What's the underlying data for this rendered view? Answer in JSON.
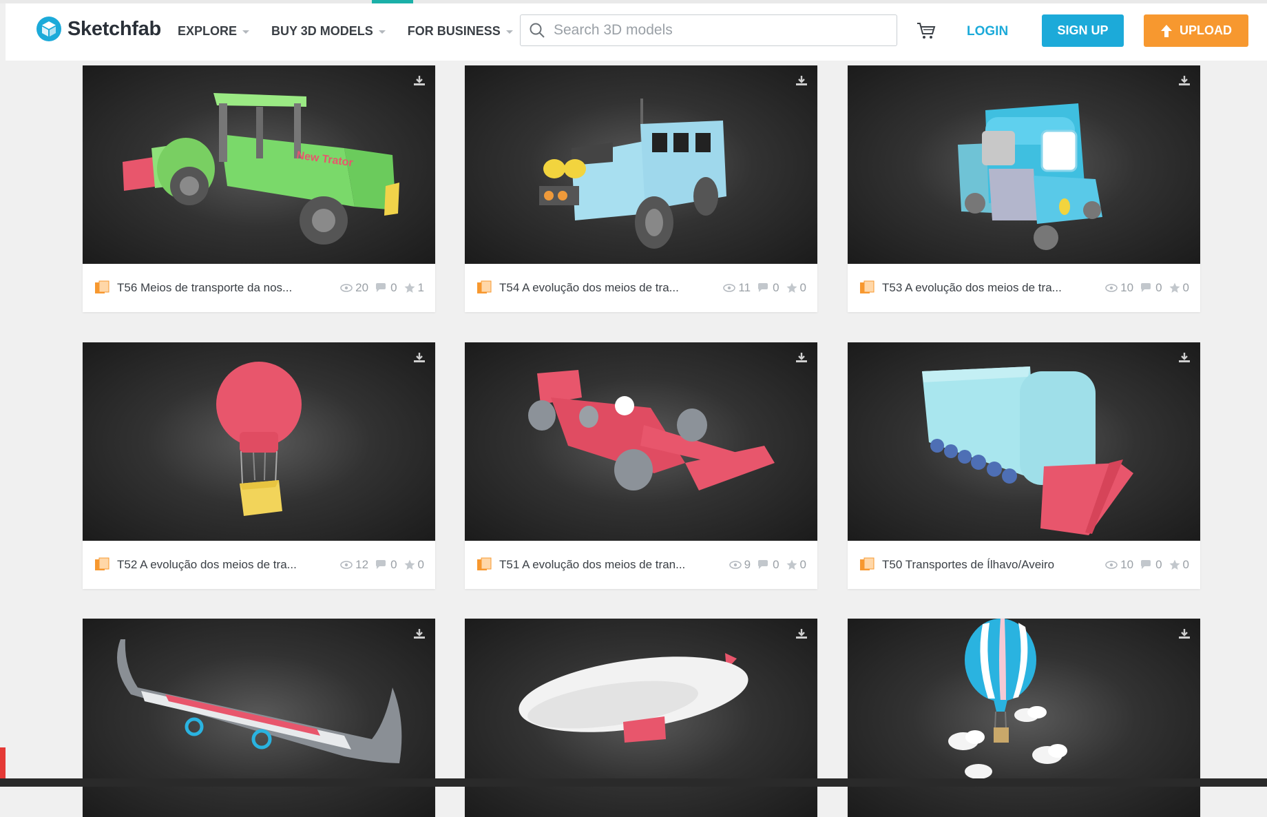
{
  "brand": {
    "name": "Sketchfab",
    "accent": "#1caad9"
  },
  "nav": [
    {
      "label": "EXPLORE"
    },
    {
      "label": "BUY 3D MODELS"
    },
    {
      "label": "FOR BUSINESS"
    }
  ],
  "search": {
    "placeholder": "Search 3D models",
    "value": ""
  },
  "auth": {
    "login": "LOGIN",
    "signup": "SIGN UP",
    "upload": "UPLOAD"
  },
  "colors": {
    "upload": "#f7982f",
    "signup": "#1caad9"
  },
  "cards": [
    {
      "title": "T56 Meios de transporte da nos...",
      "views": "20",
      "comments": "0",
      "likes": "1"
    },
    {
      "title": "T54 A evolução dos meios de tra...",
      "views": "11",
      "comments": "0",
      "likes": "0"
    },
    {
      "title": "T53 A evolução dos meios de tra...",
      "views": "10",
      "comments": "0",
      "likes": "0"
    },
    {
      "title": "T52 A evolução dos meios de tra...",
      "views": "12",
      "comments": "0",
      "likes": "0"
    },
    {
      "title": "T51 A evolução dos meios de tran...",
      "views": "9",
      "comments": "0",
      "likes": "0"
    },
    {
      "title": "T50 Transportes de Ílhavo/Aveiro",
      "views": "10",
      "comments": "0",
      "likes": "0"
    },
    {
      "title": "",
      "views": "",
      "comments": "",
      "likes": ""
    },
    {
      "title": "",
      "views": "",
      "comments": "",
      "likes": ""
    },
    {
      "title": "",
      "views": "",
      "comments": "",
      "likes": ""
    }
  ],
  "icons": [
    "logo-icon",
    "search-icon",
    "cart-icon",
    "upload-arrow-icon",
    "download-icon",
    "model-icon",
    "eye-icon",
    "comment-icon",
    "star-icon"
  ]
}
